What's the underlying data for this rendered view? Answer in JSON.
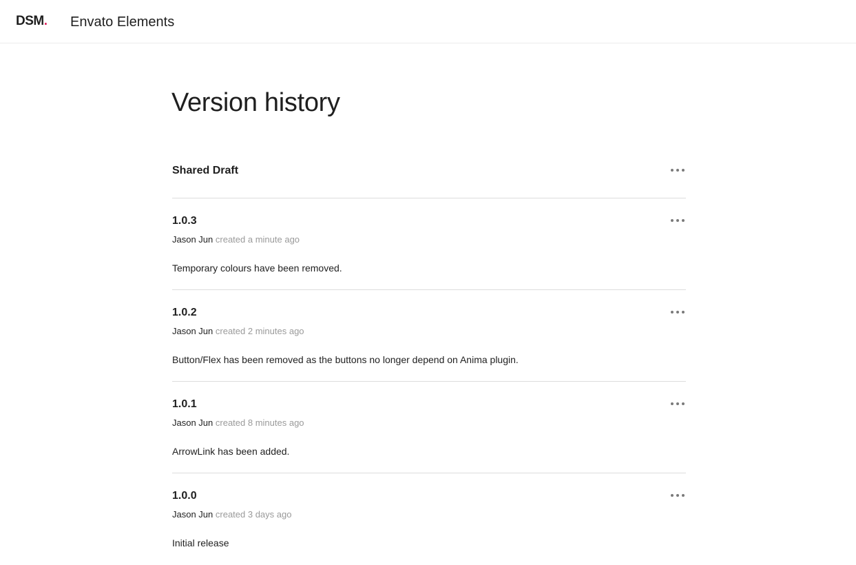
{
  "header": {
    "logo_text": "DSM",
    "logo_dot": ".",
    "project_name": "Envato Elements"
  },
  "page": {
    "title": "Version history"
  },
  "draft": {
    "label": "Shared Draft"
  },
  "versions": [
    {
      "version": "1.0.3",
      "author": "Jason Jun",
      "created": "created a minute ago",
      "description": "Temporary colours have been removed."
    },
    {
      "version": "1.0.2",
      "author": "Jason Jun",
      "created": "created 2 minutes ago",
      "description": "Button/Flex has been removed as the buttons no longer depend on Anima plugin."
    },
    {
      "version": "1.0.1",
      "author": "Jason Jun",
      "created": "created 8 minutes ago",
      "description": "ArrowLink has been added."
    },
    {
      "version": "1.0.0",
      "author": "Jason Jun",
      "created": "created 3 days ago",
      "description": "Initial release"
    }
  ],
  "icons": {
    "menu": "more-horizontal-icon"
  },
  "colors": {
    "brand_dot": "#e0245e",
    "divider": "#dcdcdc",
    "muted_text": "#9a9a9a"
  }
}
